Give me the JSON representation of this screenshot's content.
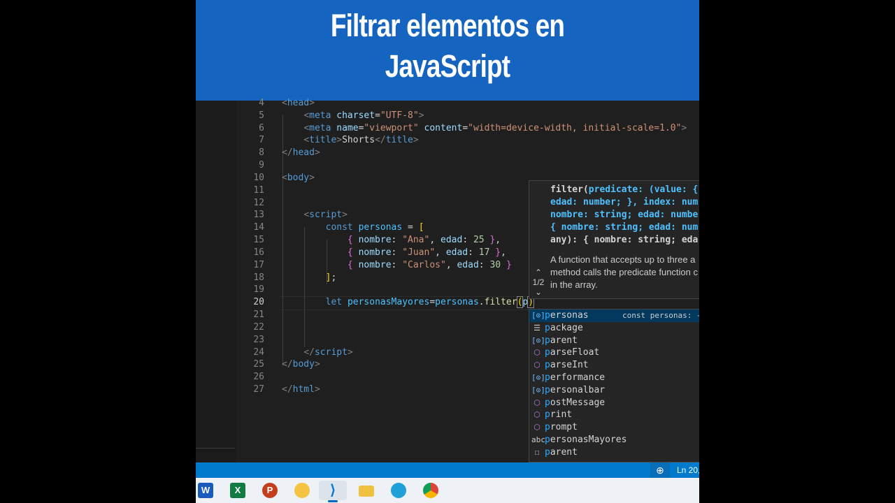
{
  "banner": {
    "line1": "Filtrar elementos en",
    "line2": "JavaScript"
  },
  "editor": {
    "line_numbers": [
      "4",
      "5",
      "6",
      "7",
      "8",
      "9",
      "10",
      "11",
      "12",
      "13",
      "14",
      "15",
      "16",
      "17",
      "18",
      "19",
      "20",
      "21",
      "22",
      "23",
      "24",
      "25",
      "26",
      "27"
    ],
    "active_line": "20",
    "code": {
      "l4_tag": "head",
      "l5_tag": "meta",
      "l5_attr": "charset",
      "l5_val": "\"UTF-8\"",
      "l6_tag": "meta",
      "l6_attr1": "name",
      "l6_val1": "\"viewport\"",
      "l6_attr2": "content",
      "l6_val2": "\"width=device-width, initial-scale=1.0\"",
      "l7_tag": "title",
      "l7_text": "Shorts",
      "l8_tag": "head",
      "l10_tag": "body",
      "l13_tag": "script",
      "l14_kw": "const",
      "l14_var": "personas",
      "l15_nk": "nombre",
      "l15_nv": "\"Ana\"",
      "l15_ek": "edad",
      "l15_ev": "25",
      "l16_nk": "nombre",
      "l16_nv": "\"Juan\"",
      "l16_ek": "edad",
      "l16_ev": "17",
      "l17_nk": "nombre",
      "l17_nv": "\"Carlos\"",
      "l17_ek": "edad",
      "l17_ev": "30",
      "l20_kw": "let",
      "l20_var": "personasMayores",
      "l20_obj": "personas",
      "l20_fn": "filter",
      "l20_typed": "p",
      "l24_tag": "script",
      "l25_tag": "body",
      "l27_tag": "html"
    }
  },
  "hover": {
    "sig_fn": "filter(",
    "sig_param": "predicate: (value: {",
    "sig_line2": "edad: number; }, index: num",
    "sig_line3": "nombre: string; edad: numbe",
    "sig_line4": "{ nombre: string; edad: num",
    "sig_line5": "any): { nombre: string; eda",
    "doc_line1": "A function that accepts up to three a",
    "doc_line2": "method calls the predicate function c",
    "doc_line3": "in the array.",
    "counter": "1/2",
    "up_icon": "chevron-up-icon",
    "down_icon": "chevron-down-icon"
  },
  "suggest": {
    "items": [
      {
        "rest": "ersonas",
        "match": "p",
        "icon": "variable-icon",
        "detail": "const personas: -"
      },
      {
        "rest": "ackage",
        "match": "p",
        "icon": "keyword-icon"
      },
      {
        "rest": "arent",
        "match": "p",
        "icon": "variable-icon"
      },
      {
        "rest": "arseFloat",
        "match": "p",
        "icon": "method-icon"
      },
      {
        "rest": "arseInt",
        "match": "p",
        "icon": "method-icon"
      },
      {
        "rest": "erformance",
        "match": "p",
        "icon": "variable-icon"
      },
      {
        "rest": "ersonalbar",
        "match": "p",
        "icon": "variable-icon"
      },
      {
        "rest": "ostMessage",
        "match": "p",
        "icon": "method-icon"
      },
      {
        "rest": "rint",
        "match": "p",
        "icon": "method-icon"
      },
      {
        "rest": "rompt",
        "match": "p",
        "icon": "method-icon"
      },
      {
        "rest": "ersonasMayores",
        "match": "p",
        "icon": "text-icon",
        "prefix": "abc"
      },
      {
        "rest": "arent",
        "match": "p",
        "icon": "snippet-icon"
      }
    ]
  },
  "status": {
    "position": "Ln 20,",
    "zoom_icon": "zoom-icon"
  },
  "taskbar": {
    "apps": [
      {
        "name": "word",
        "label": "W",
        "color": "#185abd"
      },
      {
        "name": "excel",
        "label": "X",
        "color": "#107c41"
      },
      {
        "name": "powerpoint",
        "label": "P",
        "color": "#c43e1c"
      },
      {
        "name": "folder-app",
        "label": "",
        "color": "#f5c342"
      },
      {
        "name": "vscode",
        "label": "",
        "color": "#0078d4"
      },
      {
        "name": "file-explorer",
        "label": "",
        "color": "#f0c040"
      },
      {
        "name": "edge",
        "label": "",
        "color": "#1fa0d6"
      },
      {
        "name": "chrome",
        "label": "",
        "color": "#db4437"
      }
    ]
  }
}
